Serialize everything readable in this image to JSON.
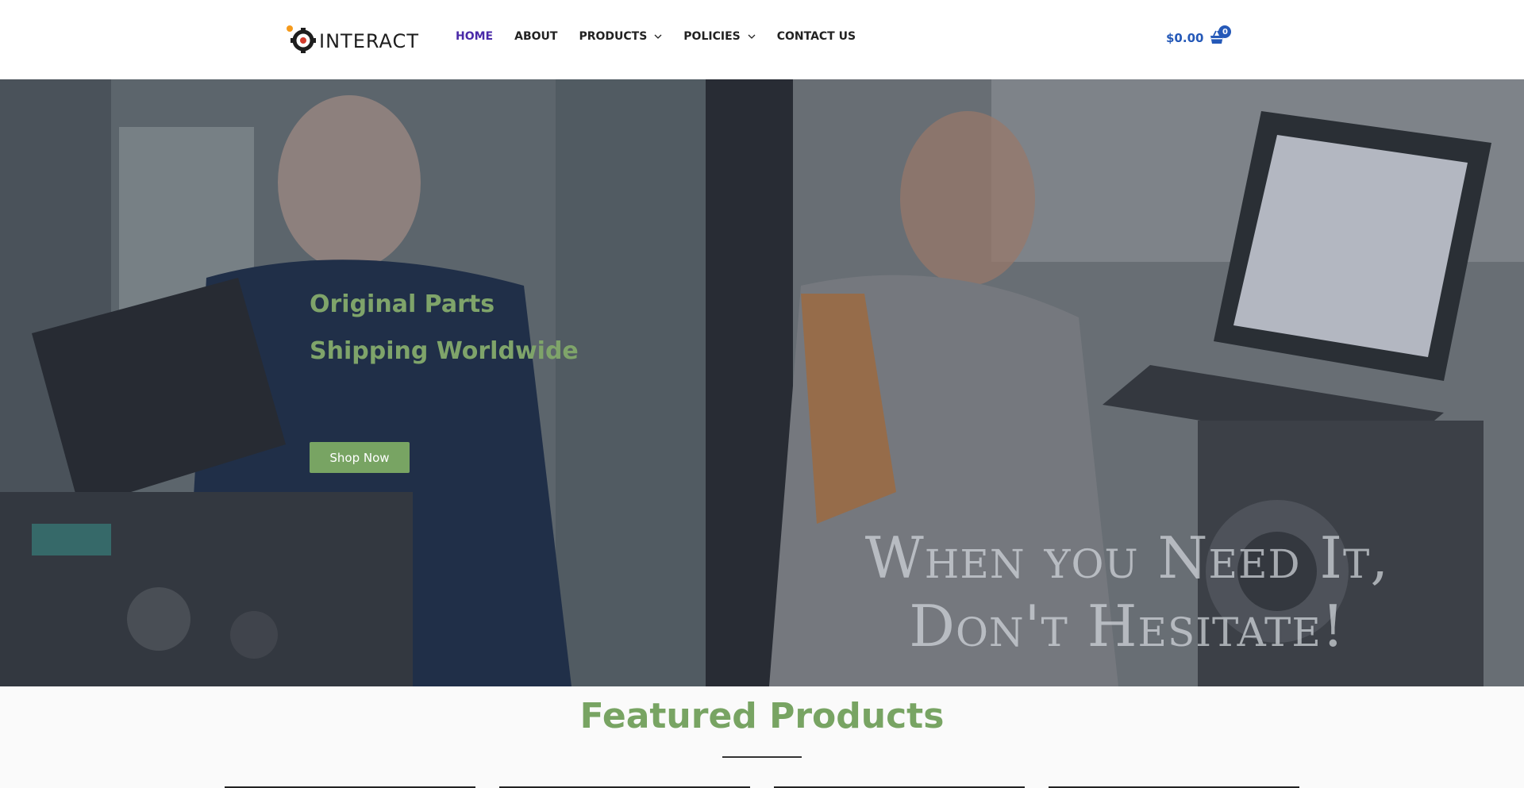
{
  "header": {
    "logo_text": "INTERACT",
    "nav": [
      {
        "label": "HOME",
        "active": true,
        "dropdown": false
      },
      {
        "label": "ABOUT",
        "active": false,
        "dropdown": false
      },
      {
        "label": "PRODUCTS",
        "active": false,
        "dropdown": true
      },
      {
        "label": "POLICIES",
        "active": false,
        "dropdown": true
      },
      {
        "label": "CONTACT US",
        "active": false,
        "dropdown": false
      }
    ],
    "cart": {
      "total": "$0.00",
      "count": "0",
      "icon": "shopping-basket-icon"
    }
  },
  "hero": {
    "line1": "Original Parts",
    "line2": "Shipping Worldwide",
    "button_label": "Shop Now",
    "tagline_line1": "When you Need It,",
    "tagline_line2": "Don't Hesitate!"
  },
  "featured": {
    "title": "Featured Products"
  },
  "colors": {
    "accent_green": "#78a463",
    "active_nav": "#4a2aa8",
    "cart_blue": "#2559b8"
  }
}
